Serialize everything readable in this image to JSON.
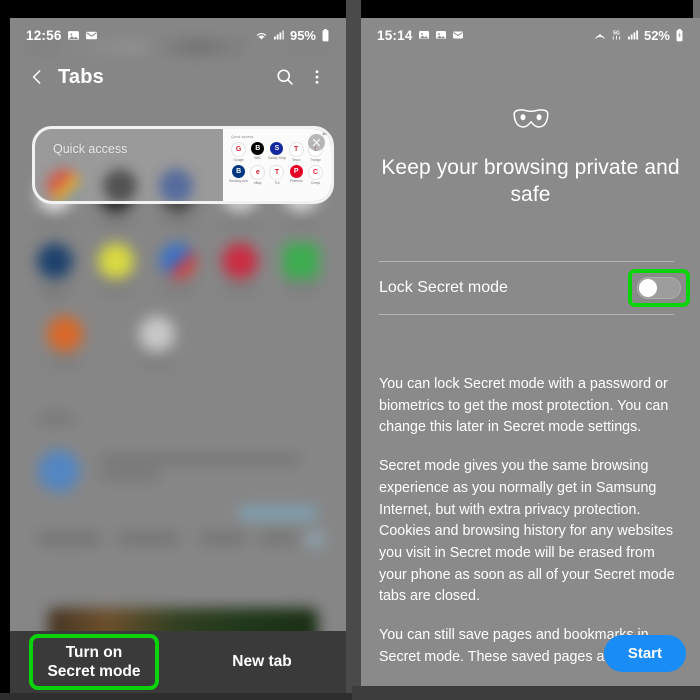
{
  "colors": {
    "highlight_green": "#0ad30a",
    "start_button_blue": "#1a8cf5",
    "panel_bg_left": "#868686",
    "panel_bg_right": "#8a8a8a",
    "bottom_bar": "#3a3a3a"
  },
  "left_panel": {
    "status_bar": {
      "time": "12:56",
      "left_icons": [
        "image-icon",
        "mail-icon"
      ],
      "right_icons": [
        "wifi-icon",
        "signal-icon"
      ],
      "battery_percent": "95%",
      "battery_icon": "battery-icon"
    },
    "header": {
      "back_icon": "back-chevron-icon",
      "title": "Tabs",
      "search_icon": "search-icon",
      "more_icon": "more-vertical-icon"
    },
    "quick_access_card": {
      "label": "Quick access",
      "close_icon": "close-icon",
      "tab_count": "2/8",
      "thumbnail_title": "Quick access",
      "apps": [
        {
          "name": "Google",
          "color": "#ffffff",
          "glyph": "G"
        },
        {
          "name": "BBC",
          "color": "#000000",
          "glyph": "B"
        },
        {
          "name": "Galaxy Shop",
          "color": "#1428a0",
          "glyph": "S"
        },
        {
          "name": "Tesco",
          "color": "#ffffff",
          "glyph": "T"
        },
        {
          "name": "Trivago",
          "color": "#ffffff",
          "glyph": "t"
        },
        {
          "name": "Booking.com",
          "color": "#003580",
          "glyph": "B"
        },
        {
          "name": "eBay",
          "color": "#ffffff",
          "glyph": "e"
        },
        {
          "name": "TUI",
          "color": "#ffffff",
          "glyph": "T"
        },
        {
          "name": "Pinterest",
          "color": "#e60023",
          "glyph": "P"
        },
        {
          "name": "Currys",
          "color": "#ffffff",
          "glyph": "C"
        }
      ]
    },
    "bottom_bar": {
      "turn_on_secret_mode": "Turn on\nSecret mode",
      "new_tab": "New tab"
    }
  },
  "right_panel": {
    "status_bar": {
      "time": "15:14",
      "left_icons": [
        "image-icon",
        "image-icon",
        "mail-icon"
      ],
      "right_icons": [
        "location-icon",
        "5g-icon",
        "signal-icon"
      ],
      "battery_percent": "52%",
      "battery_icon": "battery-charging-icon"
    },
    "mask_icon": "secret-mask-icon",
    "heading": "Keep your browsing private and safe",
    "lock_setting": {
      "label": "Lock Secret mode",
      "toggle_state": "off"
    },
    "paragraphs": [
      "You can lock Secret mode with a password or biometrics to get the most protection. You can change this later in Secret mode settings.",
      "Secret mode gives you the same browsing experience as you normally get in Samsung Internet, but with extra privacy protection. Cookies and browsing history for any websites you visit in Secret mode will be erased from your phone as soon as all of your Secret mode tabs are closed.",
      "You can still save pages and bookmarks in Secret mode. These saved pages and"
    ],
    "start_button": "Start"
  }
}
